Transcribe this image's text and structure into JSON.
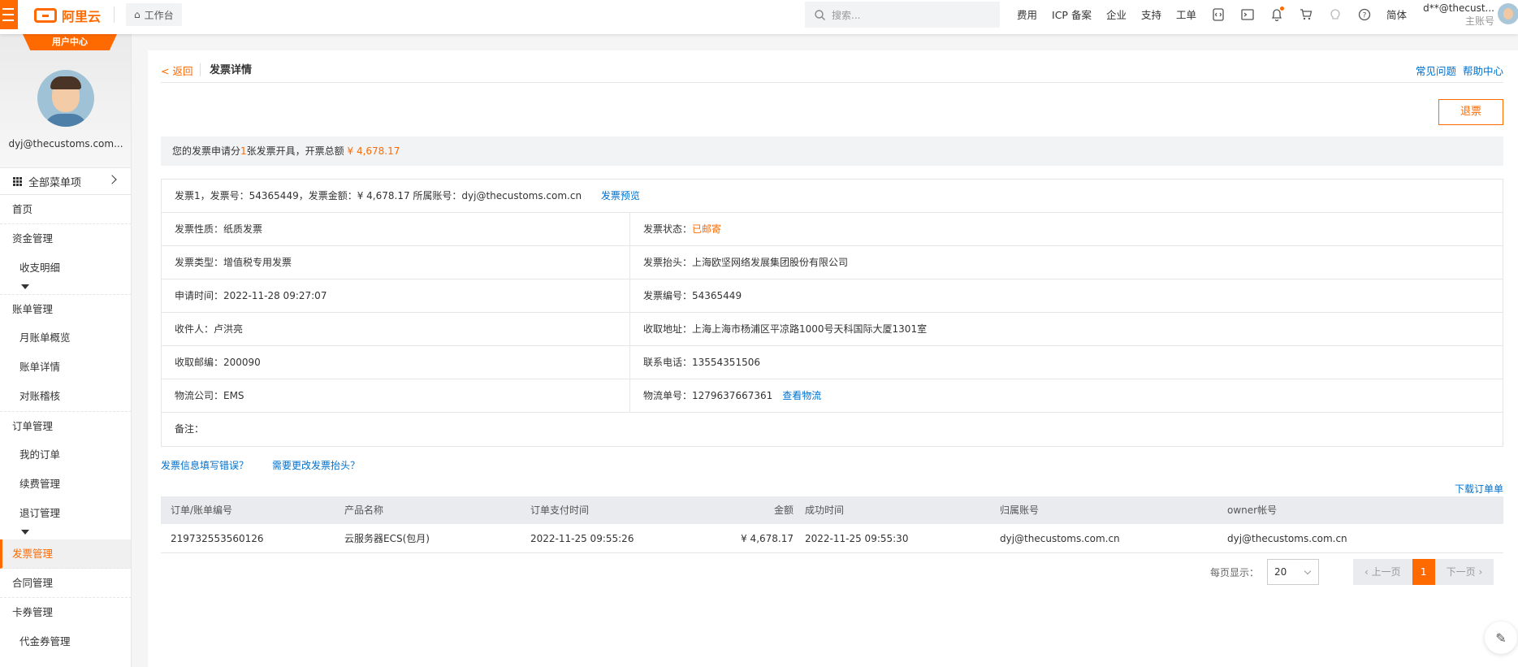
{
  "topbar": {
    "logo": "阿里云",
    "workbench": "工作台",
    "search_placeholder": "搜索...",
    "links": [
      "费用",
      "ICP 备案",
      "企业",
      "支持",
      "工单"
    ],
    "lang": "简体",
    "user_name": "d**@thecust...",
    "user_role": "主账号",
    "accent": "#ff6a00"
  },
  "sidebar": {
    "tab": "用户中心",
    "email": "dyj@thecustoms.com...",
    "all_menu": "全部菜单项",
    "nav": {
      "home": "首页",
      "funds": "资金管理",
      "income": "收支明细",
      "bills": "账单管理",
      "monthly": "月账单概览",
      "bill_detail": "账单详情",
      "reconcile": "对账稽核",
      "orders": "订单管理",
      "my_orders": "我的订单",
      "renew": "续费管理",
      "unsubscribe": "退订管理",
      "invoice": "发票管理",
      "contract": "合同管理",
      "coupons": "卡券管理",
      "vouchers": "代金券管理"
    }
  },
  "page": {
    "back": "< 返回",
    "title": "发票详情",
    "faq": "常见问题",
    "help": "帮助中心",
    "refund": "退票",
    "summary_prefix": "您的发票申请分",
    "summary_count": "1",
    "summary_mid": "张发票开具，开票总额",
    "summary_total": "¥ 4,678.17",
    "invoice_line": "发票1，发票号：54365449，发票金额：¥ 4,678.17  所属账号：dyj@thecustoms.com.cn",
    "preview": "发票预览",
    "nature": "发票性质：纸质发票",
    "status_label": "发票状态：",
    "status_value": "已邮寄",
    "type": "发票类型：增值税专用发票",
    "header_title": "发票抬头：上海欧坚网络发展集团股份有限公司",
    "apply_time": "申请时间：2022-11-28 09:27:07",
    "number": "发票编号：54365449",
    "recipient": "收件人：卢洪亮",
    "address": "收取地址：上海上海市杨浦区平凉路1000号天科国际大厦1301室",
    "postcode": "收取邮编：200090",
    "phone": "联系电话：13554351506",
    "logistics": "物流公司：EMS",
    "tracking": "物流单号：1279637667361",
    "view_logistics": "查看物流",
    "remark": "备注：",
    "err_link": "发票信息填写错误？",
    "change_header_link": "需要更改发票抬头？",
    "download": "下载订单单"
  },
  "table": {
    "headers": [
      "订单/账单编号",
      "产品名称",
      "订单支付时间",
      "金额",
      "成功时间",
      "归属账号",
      "owner帐号"
    ],
    "rows": [
      [
        "219732553560126",
        "云服务器ECS(包月)",
        "2022-11-25 09:55:26",
        "¥ 4,678.17",
        "2022-11-25 09:55:30",
        "dyj@thecustoms.com.cn",
        "dyj@thecustoms.com.cn"
      ]
    ]
  },
  "pager": {
    "label": "每页显示：",
    "size": "20",
    "prev": "‹ 上一页",
    "current": "1",
    "next": "下一页 ›"
  }
}
